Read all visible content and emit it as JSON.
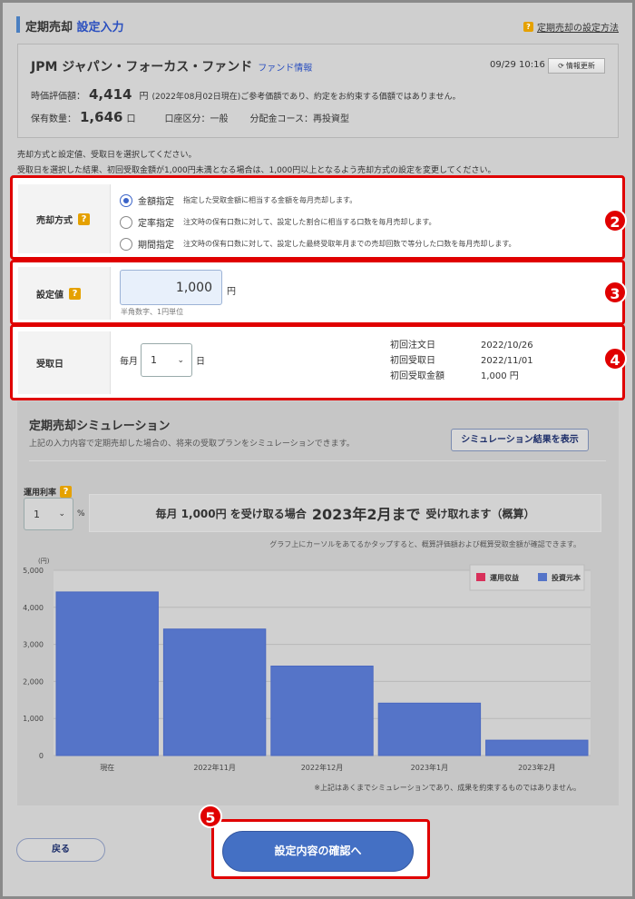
{
  "header": {
    "title": "定期売却",
    "subtitle": "設定入力",
    "help_link": "定期売却の設定方法"
  },
  "fund": {
    "name": "JPM ジャパン・フォーカス・ファンド",
    "info_link": "ファンド情報",
    "timestamp": "09/29 10:16",
    "refresh_label": "情報更新",
    "value_label": "時価評価額：",
    "value": "4,414",
    "value_unit": "円",
    "value_note": "(2022年08月02日現在)ご参考価額であり、約定をお約束する価額ではありません。",
    "holding_label": "保有数量：",
    "holding": "1,646",
    "holding_unit": "口",
    "account": "口座区分：一般",
    "course": "分配金コース：再投資型"
  },
  "instructions": [
    "売却方式と設定値、受取日を選択してください。",
    "受取日を選択した結果、初回受取金額が1,000円未満となる場合は、1,000円以上となるよう売却方式の設定を変更してください。"
  ],
  "method": {
    "label": "売却方式",
    "options": [
      {
        "label": "金額指定",
        "desc": "指定した受取金額に相当する金額を毎月売却します。",
        "selected": true
      },
      {
        "label": "定率指定",
        "desc": "注文時の保有口数に対して、設定した割合に相当する口数を毎月売却します。",
        "selected": false
      },
      {
        "label": "期間指定",
        "desc": "注文時の保有口数に対して、設定した最終受取年月までの売却回数で等分した口数を毎月売却します。",
        "selected": false
      }
    ]
  },
  "amount": {
    "label": "設定値",
    "value": "1,000",
    "unit": "円",
    "hint": "半角数字、1円単位"
  },
  "receive": {
    "label": "受取日",
    "prefix": "毎月",
    "day": "1",
    "suffix": "日",
    "info": [
      {
        "k": "初回注文日",
        "v": "2022/10/26"
      },
      {
        "k": "初回受取日",
        "v": "2022/11/01"
      },
      {
        "k": "初回受取金額",
        "v": "1,000 円"
      }
    ]
  },
  "badges": [
    "2",
    "3",
    "4",
    "5"
  ],
  "simulation": {
    "title": "定期売却シミュレーション",
    "desc": "上記の入力内容で定期売却した場合の、将来の受取プランをシミュレーションできます。",
    "button": "シミュレーション結果を表示",
    "rate_label": "運用利率",
    "rate": "1",
    "rate_unit": "%",
    "result_pre": "毎月 1,000円 を受け取る場合",
    "result_big": "2023年2月まで",
    "result_post": "受け取れます（概算）",
    "hint": "グラフ上にカーソルをあてるかタップすると、概算評価額および概算受取金額が確認できます。",
    "disclaimer": "※上記はあくまでシミュレーションであり、成果を約束するものではありません。"
  },
  "chart_data": {
    "type": "bar",
    "unit_label": "(円)",
    "categories": [
      "現在",
      "2022年11月",
      "2022年12月",
      "2023年1月",
      "2023年2月"
    ],
    "series": [
      {
        "name": "運用収益",
        "color": "#d8305a",
        "values": [
          0,
          0,
          0,
          0,
          0
        ]
      },
      {
        "name": "投資元本",
        "color": "#5574c8",
        "values": [
          4414,
          3414,
          2414,
          1414,
          414
        ]
      }
    ],
    "ylim": [
      0,
      5000
    ],
    "yticks": [
      "0",
      "1,000",
      "2,000",
      "3,000",
      "4,000",
      "5,000"
    ],
    "legend": "top-right"
  },
  "footer": {
    "back": "戻る",
    "confirm": "設定内容の確認へ"
  }
}
